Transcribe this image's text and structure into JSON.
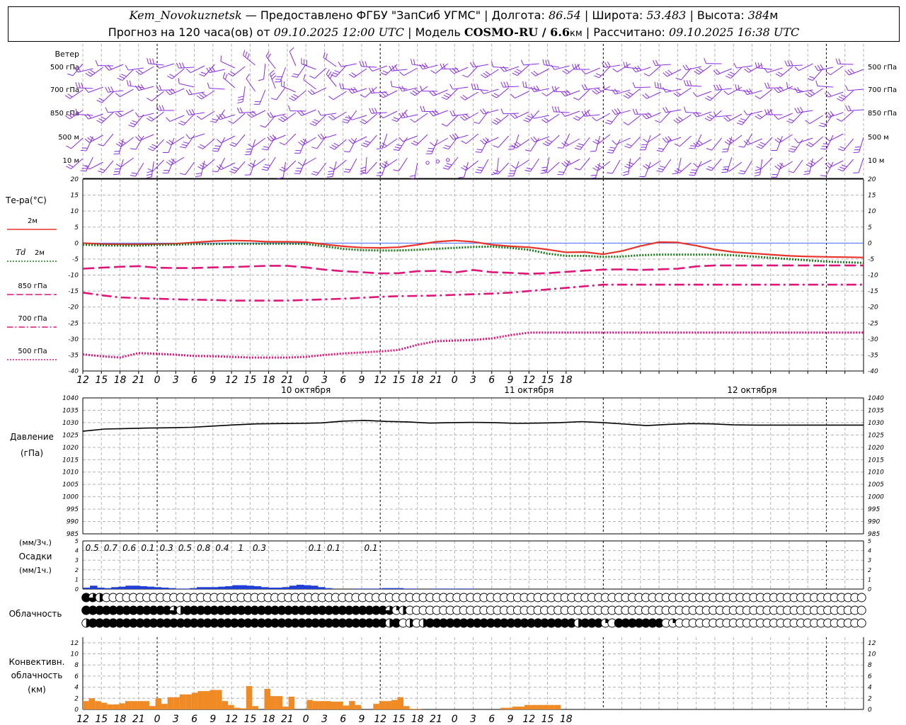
{
  "header": {
    "station": "Kem_Novokuznetsk",
    "provider": " — Предоставлено ФГБУ \"ЗапСиб УГМС\" | Долгота: ",
    "longitude": "86.54",
    "lat_label": " | Широта: ",
    "latitude": "53.483",
    "alt_label": " | Высота: ",
    "altitude": "384",
    "alt_unit": "м",
    "forecast_label": "Прогноз на 120 часа(ов) от ",
    "forecast_from": "09.10.2025 12:00 UTC",
    "model_label": "  | Модель ",
    "model": "COSMO-RU / 6.6",
    "model_unit": "км",
    "calc_label": " | Рассчитано: ",
    "calculated": "09.10.2025 16:38 UTC"
  },
  "colors": {
    "wind": "#8a2be2",
    "t2m": "#e8332a",
    "td2m": "#1a7a1a",
    "t850": "#e0157a",
    "t700": "#e0157a",
    "t500": "#e0157a",
    "pressure": "#000000",
    "precip": "#1f3fd6",
    "convective": "#f08a24",
    "grid": "#b4b4b4",
    "ref_line": "#4a6cff"
  },
  "chart_data": [
    {
      "type": "wind_barbs",
      "title": "Ветер",
      "levels": [
        "500 гПа",
        "700 гПа",
        "850 гПа",
        "500 м",
        "10 м"
      ],
      "note": "wind barbs at 3-hourly steps; directions predominantly westerly to south-westerly"
    },
    {
      "type": "line",
      "title": "Те-ра(°C)",
      "x": [
        0,
        3,
        6,
        9,
        12,
        15,
        18,
        21,
        24,
        27,
        30,
        33,
        36,
        39,
        42,
        45,
        48,
        51,
        54,
        57,
        60,
        63,
        66,
        69,
        72,
        75,
        78,
        81,
        84,
        87,
        90,
        93,
        96,
        99,
        102,
        105,
        108,
        111,
        114,
        117,
        120,
        123,
        126
      ],
      "xlim": [
        0,
        126
      ],
      "ylim": [
        -40,
        20
      ],
      "yticks": [
        20,
        15,
        10,
        5,
        0,
        -5,
        -10,
        -15,
        -20,
        -25,
        -30,
        -35,
        -40
      ],
      "series": [
        {
          "name": "2м",
          "style": "solid",
          "values": [
            0,
            -0.3,
            -0.4,
            -0.4,
            -0.3,
            -0.2,
            0.2,
            0.6,
            0.8,
            0.7,
            0.4,
            0.4,
            0.3,
            -0.4,
            -1,
            -1.4,
            -1.5,
            -1.3,
            -0.5,
            0.4,
            0.8,
            0.4,
            -0.5,
            -1,
            -1.3,
            -2,
            -2.9,
            -2.8,
            -3.5,
            -2.5,
            -0.9,
            0.3,
            0.2,
            -0.8,
            -2,
            -2.8,
            -3.2,
            -3.6,
            -4.0,
            -4.2,
            -4.3,
            -4.4,
            -4.5
          ]
        },
        {
          "name": "Td 2м",
          "style": "dotted",
          "values": [
            -0.5,
            -0.7,
            -0.8,
            -0.8,
            -0.6,
            -0.5,
            -0.3,
            -0.3,
            -0.2,
            -0.2,
            -0.2,
            -0.2,
            -0.3,
            -1,
            -1.8,
            -2.2,
            -2.3,
            -2.3,
            -2.1,
            -1.8,
            -1.5,
            -1.2,
            -1.1,
            -1.5,
            -2.1,
            -3.3,
            -4,
            -4,
            -4.3,
            -4.2,
            -3.8,
            -3.6,
            -3.6,
            -3.6,
            -3.6,
            -3.8,
            -4.2,
            -4.6,
            -5,
            -5.4,
            -5.8,
            -6.0,
            -6.2
          ]
        },
        {
          "name": "850 гПа",
          "style": "dashed",
          "values": [
            -8,
            -7.7,
            -7.4,
            -7.2,
            -7.7,
            -7.8,
            -7.8,
            -7.6,
            -7.5,
            -7.3,
            -7.1,
            -7.1,
            -7.6,
            -8.3,
            -8.8,
            -9.1,
            -9.5,
            -9.4,
            -8.8,
            -8.7,
            -9.2,
            -8.4,
            -9.1,
            -9.3,
            -9.6,
            -9.4,
            -9.0,
            -8.6,
            -8.3,
            -8.2,
            -8.4,
            -8.2,
            -8.0,
            -7.3,
            -7.0,
            -7.0,
            -7.0,
            -7.0,
            -7.0,
            -7.0,
            -7.0,
            -7.0,
            -7.0
          ]
        },
        {
          "name": "700 гПа",
          "style": "dashdot",
          "values": [
            -15.5,
            -16.3,
            -17.0,
            -17.2,
            -17.4,
            -17.6,
            -17.7,
            -17.8,
            -18.0,
            -18.0,
            -18.0,
            -18.0,
            -17.8,
            -17.6,
            -17.4,
            -17.1,
            -16.8,
            -16.6,
            -16.5,
            -16.4,
            -16.2,
            -16.0,
            -15.8,
            -15.5,
            -15.0,
            -14.5,
            -14.0,
            -13.5,
            -13.0,
            -13.0,
            -13.0,
            -13.0,
            -13.0,
            -13.0,
            -13.0,
            -13.0,
            -13.0,
            -13.0,
            -13.0,
            -13.0,
            -13.0,
            -13.0,
            -13.0
          ]
        },
        {
          "name": "500 гПа",
          "style": "dotted",
          "values": [
            -34.8,
            -35.4,
            -35.8,
            -34.4,
            -34.6,
            -34.9,
            -35.3,
            -35.4,
            -35.6,
            -35.8,
            -35.8,
            -35.8,
            -35.6,
            -35.0,
            -34.5,
            -34.2,
            -33.9,
            -33.4,
            -31.8,
            -30.7,
            -30.5,
            -30.3,
            -29.8,
            -28.8,
            -28.0,
            -28.0,
            -28.0,
            -28.0,
            -28.0,
            -28.0,
            -28.0,
            -28.0,
            -28.0,
            -28.0,
            -28.0,
            -28.0,
            -28.0,
            -28.0,
            -28.0,
            -28.0,
            -28.0,
            -28.0,
            -28.0
          ]
        }
      ]
    },
    {
      "type": "line",
      "title": "Давление",
      "ylabel": "(гПа)",
      "ylim": [
        985,
        1040
      ],
      "yticks": [
        1040,
        1035,
        1030,
        1025,
        1020,
        1015,
        1010,
        1005,
        1000,
        995,
        990,
        985
      ],
      "x": [
        0,
        3,
        6,
        9,
        12,
        15,
        18,
        21,
        24,
        27,
        30,
        33,
        36,
        39,
        42,
        45,
        48,
        51,
        54,
        57,
        60,
        63,
        66,
        69,
        72,
        75,
        78,
        81,
        84,
        87,
        90,
        93,
        96,
        99,
        102,
        105,
        108
      ],
      "series": [
        {
          "name": "Давление",
          "values": [
            1026.5,
            1027.4,
            1027.6,
            1027.8,
            1027.9,
            1028.1,
            1028.6,
            1029.1,
            1029.5,
            1029.6,
            1029.7,
            1029.9,
            1030.6,
            1030.9,
            1030.5,
            1030.3,
            1029.8,
            1030.0,
            1030.1,
            1030.0,
            1029.7,
            1029.8,
            1030.0,
            1030.4,
            1030.0,
            1029.4,
            1028.8,
            1029.3,
            1029.6,
            1029.5,
            1029.1,
            1029.0,
            1029.0,
            1029.0,
            1029.0,
            1029.0,
            1029.0
          ]
        }
      ]
    },
    {
      "type": "bar",
      "title": "Осадки",
      "ylabel": "(мм/1ч.)",
      "ylabel2": "(мм/3ч.)",
      "ylim": [
        0,
        5
      ],
      "yticks": [
        5,
        4,
        3,
        2,
        1,
        0
      ],
      "totals_3h": [
        {
          "x": 1.5,
          "label": "0.5"
        },
        {
          "x": 4.5,
          "label": "0.7"
        },
        {
          "x": 7.5,
          "label": "0.6"
        },
        {
          "x": 10.5,
          "label": "0.1"
        },
        {
          "x": 13.5,
          "label": "0.3"
        },
        {
          "x": 16.5,
          "label": "0.5"
        },
        {
          "x": 19.5,
          "label": "0.8"
        },
        {
          "x": 22.5,
          "label": "0.4"
        },
        {
          "x": 25.5,
          "label": "1"
        },
        {
          "x": 28.5,
          "label": "0.3"
        },
        {
          "x": 37.5,
          "label": "0.1"
        },
        {
          "x": 40.5,
          "label": "0.1"
        },
        {
          "x": 46.5,
          "label": "0.1"
        }
      ],
      "hourly": [
        0.15,
        0.35,
        0.15,
        0.1,
        0.2,
        0.25,
        0.35,
        0.35,
        0.3,
        0.25,
        0.2,
        0.15,
        0.1,
        0.05,
        0.05,
        0.1,
        0.2,
        0.2,
        0.2,
        0.25,
        0.3,
        0.4,
        0.4,
        0.35,
        0.3,
        0.2,
        0.15,
        0.15,
        0.2,
        0.35,
        0.45,
        0.4,
        0.35,
        0.2,
        0.1,
        0,
        0,
        0,
        0.05,
        0.05,
        0.05,
        0.05,
        0.1,
        0.1,
        0.1,
        0.05,
        0.05,
        0,
        0,
        0.05,
        0.05,
        0.05,
        0.05,
        0.05,
        0.05,
        0,
        0
      ]
    },
    {
      "type": "cloud_cover",
      "title": "Облачность",
      "rows": [
        [
          4,
          3,
          2,
          0,
          0,
          0,
          0,
          0,
          0,
          0,
          0,
          0,
          0,
          0,
          0,
          0,
          0,
          0,
          0,
          0,
          0,
          0,
          0,
          0,
          0,
          0,
          0,
          0,
          0,
          0,
          0,
          0,
          0,
          0,
          0,
          0,
          0,
          0,
          0,
          0,
          0,
          0,
          0,
          0,
          0,
          0,
          0,
          0,
          0,
          0,
          0,
          0,
          0,
          0,
          0,
          0,
          0,
          0,
          0,
          0,
          0,
          0,
          0,
          0,
          0,
          0,
          0,
          0,
          0,
          0,
          0,
          0,
          0,
          0,
          0,
          0,
          0,
          0,
          0,
          0,
          0,
          0,
          0,
          0,
          0,
          0,
          0,
          0,
          0,
          0,
          0,
          0,
          0,
          0,
          0,
          0,
          0,
          0,
          0,
          0,
          0,
          0,
          0,
          0,
          0,
          0,
          0,
          0,
          0,
          0,
          0,
          0,
          0,
          0,
          0,
          0
        ],
        [
          4,
          4,
          4,
          4,
          4,
          4,
          4,
          4,
          4,
          4,
          4,
          4,
          4,
          3,
          2,
          4,
          4,
          4,
          4,
          4,
          4,
          4,
          4,
          4,
          4,
          4,
          4,
          4,
          4,
          4,
          4,
          4,
          4,
          4,
          4,
          4,
          4,
          4,
          4,
          4,
          4,
          4,
          4,
          4,
          4,
          3,
          1,
          2,
          0,
          0,
          0,
          0,
          0,
          0,
          0,
          0,
          0,
          0,
          0,
          0,
          0,
          0,
          0,
          0,
          0,
          0,
          0,
          0,
          0,
          0,
          0,
          0,
          0,
          0,
          0,
          0,
          0,
          0,
          0,
          0,
          0,
          0,
          0,
          0,
          0,
          0,
          0,
          0,
          0,
          0,
          0,
          0,
          0,
          0,
          0,
          0,
          0,
          0,
          0,
          0,
          0,
          0,
          0,
          0,
          0,
          0,
          0,
          0,
          0,
          0,
          0,
          0,
          0,
          0,
          0,
          0
        ],
        [
          2,
          4,
          4,
          4,
          4,
          4,
          4,
          4,
          4,
          4,
          4,
          4,
          4,
          4,
          4,
          4,
          4,
          4,
          4,
          4,
          4,
          4,
          4,
          4,
          4,
          4,
          4,
          4,
          4,
          4,
          4,
          4,
          4,
          4,
          4,
          4,
          4,
          4,
          4,
          4,
          4,
          4,
          4,
          4,
          4,
          2,
          4,
          0,
          2,
          0,
          2,
          4,
          4,
          4,
          4,
          4,
          4,
          4,
          4,
          4,
          4,
          4,
          4,
          4,
          4,
          4,
          4,
          4,
          4,
          4,
          4,
          4,
          4,
          2,
          4,
          4,
          4,
          1,
          0,
          4,
          4,
          4,
          4,
          4,
          4,
          4,
          0,
          1,
          0,
          0,
          0,
          0,
          0,
          0,
          0,
          0,
          0,
          0,
          0,
          0,
          0,
          0,
          0,
          0,
          0,
          0,
          0,
          0,
          0,
          0,
          0,
          0,
          0,
          0,
          0,
          0
        ]
      ]
    },
    {
      "type": "bar",
      "title": "Конвективн. облачность",
      "ylabel": "(км)",
      "ylim": [
        0,
        13
      ],
      "yticks": [
        12,
        10,
        8,
        6,
        4,
        2,
        0
      ],
      "x": [
        0,
        1,
        2,
        3,
        4,
        5,
        6,
        7,
        8,
        9,
        10,
        11,
        12,
        13,
        14,
        15,
        16,
        17,
        18,
        19,
        20,
        21,
        22,
        23,
        24,
        25,
        26,
        27,
        28,
        29,
        30,
        31,
        32,
        33,
        34,
        35,
        36,
        37,
        38,
        39,
        40,
        41,
        42,
        43,
        44,
        45,
        46,
        47,
        48,
        49,
        50,
        51,
        52,
        53,
        54,
        55,
        56,
        57,
        58,
        59,
        60,
        61,
        62,
        63,
        64,
        65,
        66,
        67,
        68,
        69,
        70,
        71,
        72,
        73,
        74,
        75,
        76,
        77,
        78,
        79
      ],
      "values": [
        1.5,
        2,
        1.5,
        1.2,
        0.9,
        0.9,
        1.1,
        1.5,
        1.5,
        1.5,
        1.5,
        0.6,
        2,
        1,
        2.2,
        2.2,
        2.7,
        2.7,
        3,
        3.3,
        3.3,
        3.5,
        3.5,
        1.5,
        0.8,
        0.3,
        0.2,
        4.2,
        0.6,
        0,
        3.7,
        2.4,
        2.4,
        0.5,
        2.3,
        0,
        0,
        1.7,
        1.5,
        1.5,
        1.5,
        1.4,
        1.4,
        0.7,
        1.5,
        0.8,
        0,
        0,
        1,
        1.5,
        1.5,
        1.7,
        2.2,
        0.6,
        0.1,
        0.1,
        0,
        0,
        0,
        0,
        0,
        0,
        0,
        0,
        0,
        0,
        0,
        0,
        0,
        0.3,
        0.3,
        0.5,
        0.5,
        0.8,
        0.8,
        0.8,
        0.8,
        0.8,
        0.8,
        0
      ]
    }
  ],
  "axis": {
    "hour_labels": [
      "12",
      "15",
      "18",
      "21",
      "0",
      "3",
      "6",
      "9",
      "12",
      "15",
      "18",
      "21",
      "0",
      "3",
      "6",
      "9",
      "12",
      "15",
      "18",
      "21",
      "0",
      "3",
      "6",
      "9",
      "12",
      "15",
      "18"
    ],
    "date_labels": [
      "10 октября",
      "11 октября",
      "12 октября"
    ]
  },
  "labels": {
    "wind": "Ветер",
    "levels": [
      "500 гПа",
      "700 гПа",
      "850 гПа",
      "500 м",
      "10 м"
    ],
    "temp": "Те-ра(°C)",
    "t2m": "2м",
    "td": "Td",
    "td2m": "2м",
    "t850": "850 гПа",
    "t700": "700 гПа",
    "t500": "500 гПа",
    "pressure": "Давление",
    "pressure_unit": "(гПа)",
    "precip3": "(мм/3ч.)",
    "precip": "Осадки",
    "precip1": "(мм/1ч.)",
    "cloud": "Облачность",
    "conv1": "Конвективн.",
    "conv2": "облачность",
    "conv_unit": "(км)"
  }
}
